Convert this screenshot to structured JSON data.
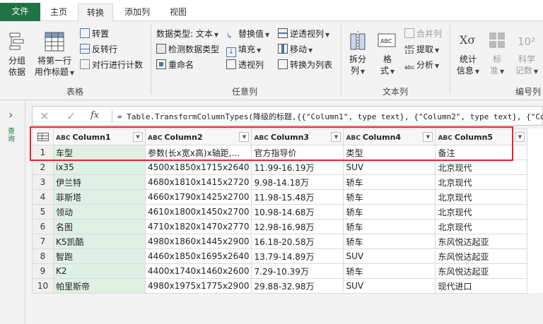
{
  "tabs": [
    {
      "label": "文件"
    },
    {
      "label": "主页"
    },
    {
      "label": "转换"
    },
    {
      "label": "添加列"
    },
    {
      "label": "视图"
    }
  ],
  "ribbon": {
    "table_group": {
      "label": "表格",
      "group_by": "分组\n依据",
      "first_row_header": "将第一行\n用作标题",
      "transpose": "转置",
      "reverse_rows": "反转行",
      "count_rows": "对行进行计数"
    },
    "any_column_group": {
      "label": "任意列",
      "data_type": "数据类型: 文本",
      "detect_type": "检测数据类型",
      "rename": "重命名",
      "replace_values": "替换值",
      "fill": "填充",
      "pivot_column": "透视列",
      "unpivot": "逆透视列",
      "move": "移动",
      "to_list": "转换为列表"
    },
    "text_column_group": {
      "label": "文本列",
      "split_column": "拆分\n列",
      "format": "格\n式",
      "merge_columns": "合并列",
      "extract": "提取",
      "parse": "分析"
    },
    "number_column_group": {
      "label": "编号列",
      "statistics": "统计\n信息",
      "standard": "标\n准",
      "scientific": "科学\n记数"
    }
  },
  "nav": {
    "queries_label": "查询"
  },
  "formula_bar": {
    "fx": "fx",
    "formula": "= Table.TransformColumnTypes(降级的标题,{{\"Column1\", type text}, {\"Column2\", type text}, {\"Co"
  },
  "grid": {
    "type_icon": "ABC",
    "columns": [
      "Column1",
      "Column2",
      "Column3",
      "Column4",
      "Column5"
    ],
    "rows": [
      [
        "1",
        "车型",
        "参数(长x宽x高)x轴距,...",
        "官方指导价",
        "类型",
        "备注"
      ],
      [
        "2",
        "ix35",
        "4500x1850x1715x2640",
        "11.99-16.19万",
        "SUV",
        "北京现代"
      ],
      [
        "3",
        "伊兰特",
        "4680x1810x1415x2720",
        "9.98-14.18万",
        "轿车",
        "北京现代"
      ],
      [
        "4",
        "菲斯塔",
        "4660x1790x1425x2700",
        "11.98-15.48万",
        "轿车",
        "北京现代"
      ],
      [
        "5",
        "领动",
        "4610x1800x1450x2700",
        "10.98-14.68万",
        "轿车",
        "北京现代"
      ],
      [
        "6",
        "名图",
        "4710x1820x1470x2770",
        "12.98-16.98万",
        "轿车",
        "北京现代"
      ],
      [
        "7",
        "K5凯酷",
        "4980x1860x1445x2900",
        "16.18-20.58万",
        "轿车",
        "东风悦达起亚"
      ],
      [
        "8",
        "智跑",
        "4460x1850x1695x2640",
        "13.79-14.89万",
        "SUV",
        "东风悦达起亚"
      ],
      [
        "9",
        "K2",
        "4400x1740x1460x2600",
        "7.29-10.39万",
        "轿车",
        "东风悦达起亚"
      ],
      [
        "10",
        "帕里斯帝",
        "4980x1975x1775x2900",
        "29.88-32.98万",
        "SUV",
        "现代进口"
      ]
    ]
  },
  "colors": {
    "accent": "#217346",
    "highlight": "#e0282c",
    "column1_fill": "#dff1e5"
  }
}
